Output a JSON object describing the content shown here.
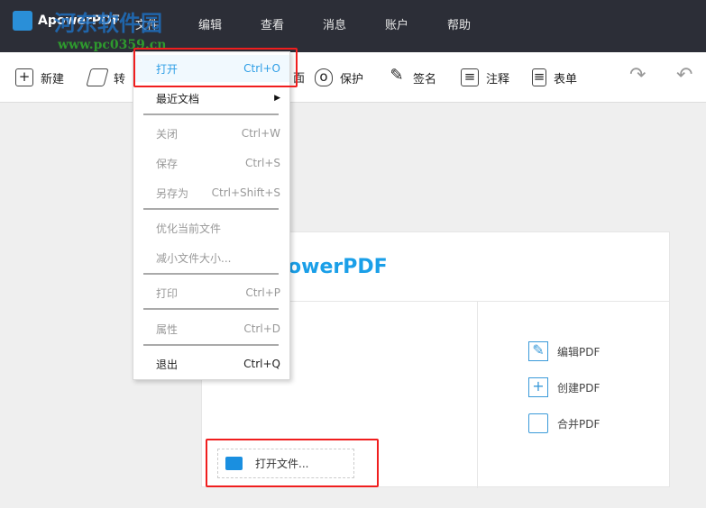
{
  "title_bar": {
    "app_name": "ApowerPDF",
    "menus": [
      "文件",
      "编辑",
      "查看",
      "消息",
      "账户",
      "帮助"
    ],
    "watermark": "河东软件园",
    "watermark_url": "www.pc0359.cn"
  },
  "toolbar": {
    "items": [
      {
        "label": "新建",
        "icon": "plus-icon"
      },
      {
        "label": "转",
        "icon": "convert-icon"
      },
      {
        "label": "保护",
        "icon": "shield-icon"
      },
      {
        "label": "签名",
        "icon": "pen-icon"
      },
      {
        "label": "注释",
        "icon": "comment-icon"
      },
      {
        "label": "表单",
        "icon": "form-icon"
      }
    ],
    "partial_label": "面"
  },
  "file_menu": {
    "items": [
      {
        "label": "打开",
        "shortcut": "Ctrl+O"
      },
      {
        "label": "最近文档",
        "shortcut": ""
      },
      {
        "label": "关闭",
        "shortcut": "Ctrl+W"
      },
      {
        "label": "保存",
        "shortcut": "Ctrl+S"
      },
      {
        "label": "另存为",
        "shortcut": "Ctrl+Shift+S"
      },
      {
        "label": "优化当前文件",
        "shortcut": ""
      },
      {
        "label": "减小文件大小...",
        "shortcut": ""
      },
      {
        "label": "打印",
        "shortcut": "Ctrl+P"
      },
      {
        "label": "属性",
        "shortcut": "Ctrl+D"
      },
      {
        "label": "退出",
        "shortcut": "Ctrl+Q"
      }
    ]
  },
  "start": {
    "brand": "owerPDF",
    "open_file": "打开文件...",
    "actions": [
      "编辑PDF",
      "创建PDF",
      "合并PDF"
    ]
  },
  "colors": {
    "accent": "#1a9fe8",
    "highlight": "#f01e1e",
    "titlebar": "#2c2e37"
  }
}
